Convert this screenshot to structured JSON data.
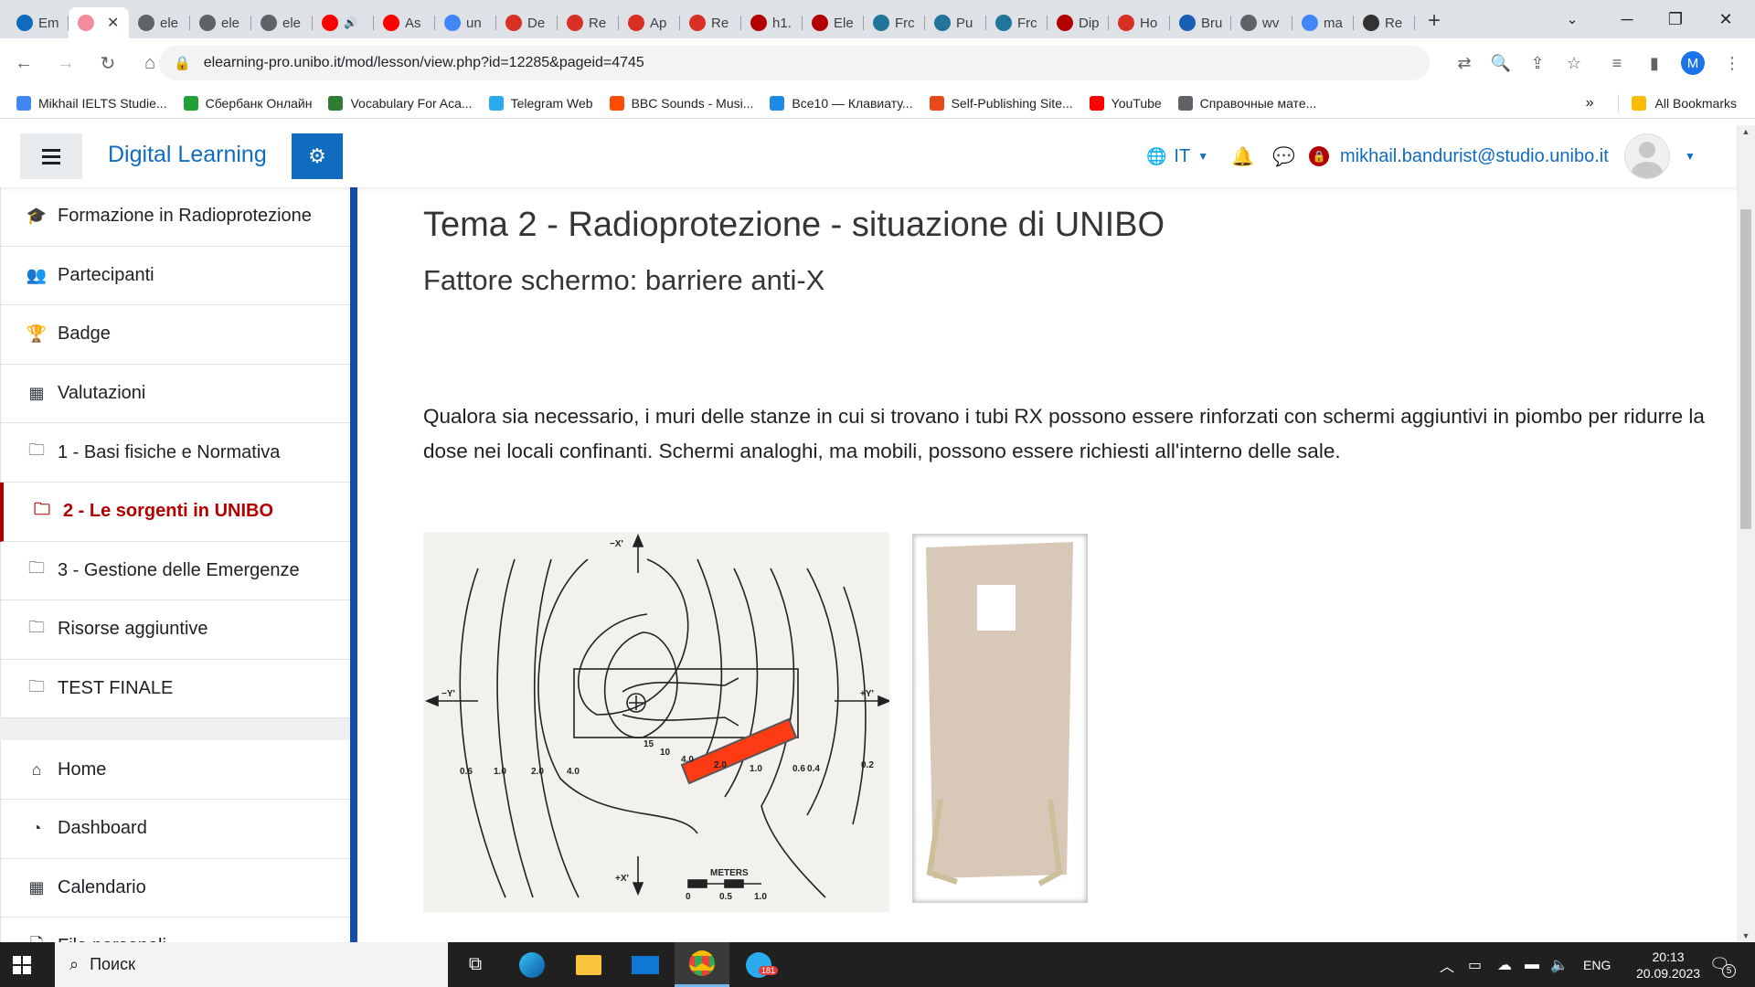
{
  "browser": {
    "tabs": [
      {
        "label": "Em",
        "icon": "outlook-icon",
        "color": "#0f6cbd"
      },
      {
        "label": "",
        "icon": "pink-flower-icon",
        "color": "#f28b9a",
        "active": true
      },
      {
        "label": "ele",
        "icon": "globe-icon",
        "color": "#5f6368"
      },
      {
        "label": "ele",
        "icon": "globe-icon",
        "color": "#5f6368"
      },
      {
        "label": "ele",
        "icon": "globe-icon",
        "color": "#5f6368"
      },
      {
        "label": "",
        "icon": "youtube-icon",
        "color": "#ff0000",
        "audio": true
      },
      {
        "label": "As",
        "icon": "youtube-icon",
        "color": "#ff0000"
      },
      {
        "label": "un",
        "icon": "google-icon",
        "color": "#4285f4"
      },
      {
        "label": "De",
        "icon": "red-circle-icon",
        "color": "#d93025"
      },
      {
        "label": "Re",
        "icon": "red-circle-icon",
        "color": "#d93025"
      },
      {
        "label": "Ap",
        "icon": "red-circle-icon",
        "color": "#d93025"
      },
      {
        "label": "Re",
        "icon": "red-star-icon",
        "color": "#d93025"
      },
      {
        "label": "h1.",
        "icon": "unibo-shield-icon",
        "color": "#b30000"
      },
      {
        "label": "Ele",
        "icon": "unibo-shield-icon",
        "color": "#b30000"
      },
      {
        "label": "Frc",
        "icon": "wordpress-icon",
        "color": "#21759b"
      },
      {
        "label": "Pu",
        "icon": "wordpress-icon",
        "color": "#21759b"
      },
      {
        "label": "Frc",
        "icon": "wordpress-icon",
        "color": "#21759b"
      },
      {
        "label": "Dip",
        "icon": "unibo-shield-icon",
        "color": "#b30000"
      },
      {
        "label": "Ho",
        "icon": "red-star-icon",
        "color": "#d93025"
      },
      {
        "label": "Bru",
        "icon": "blue-square-icon",
        "color": "#1a5fb4"
      },
      {
        "label": "wv",
        "icon": "globe-icon",
        "color": "#5f6368"
      },
      {
        "label": "ma",
        "icon": "google-icon",
        "color": "#4285f4"
      },
      {
        "label": "Re",
        "icon": "r6-icon",
        "color": "#333333"
      }
    ],
    "close_tab": "✕",
    "new_tab": "+",
    "address": "elearning-pro.unibo.it/mod/lesson/view.php?id=12285&pageid=4745",
    "profile_initial": "M",
    "bookmarks": [
      {
        "label": "Mikhail IELTS Studie...",
        "icon": "docs-icon",
        "color": "#4285f4"
      },
      {
        "label": "Сбербанк Онлайн",
        "icon": "sber-icon",
        "color": "#21a038"
      },
      {
        "label": "Vocabulary For Aca...",
        "icon": "ielts-icon",
        "color": "#2e7d32"
      },
      {
        "label": "Telegram Web",
        "icon": "telegram-icon",
        "color": "#2aabee"
      },
      {
        "label": "BBC Sounds - Musi...",
        "icon": "bbc-sounds-icon",
        "color": "#ff4c00"
      },
      {
        "label": "Все10 — Клавиату...",
        "icon": "vse10-icon",
        "color": "#1e88e5"
      },
      {
        "label": "Self-Publishing Site...",
        "icon": "p-icon",
        "color": "#e64a19"
      },
      {
        "label": "YouTube",
        "icon": "youtube-icon",
        "color": "#ff0000"
      },
      {
        "label": "Справочные мате...",
        "icon": "globe-icon",
        "color": "#5f6368"
      }
    ],
    "more_bookmarks": "»",
    "all_bookmarks": "All Bookmarks"
  },
  "moodle": {
    "site_name": "Digital Learning",
    "language": "IT",
    "user_email": "mikhail.bandurist@studio.unibo.it",
    "accent_color": "#0f6cbf",
    "active_color": "#b30000"
  },
  "drawer": {
    "course_items": [
      {
        "label": "Formazione in Radioprotezione",
        "icon": "graduation-cap-icon",
        "glyph": "🎓"
      },
      {
        "label": "Partecipanti",
        "icon": "users-icon",
        "glyph": "👥"
      },
      {
        "label": "Badge",
        "icon": "trophy-icon",
        "glyph": "🏆"
      },
      {
        "label": "Valutazioni",
        "icon": "table-icon",
        "glyph": "▦"
      },
      {
        "label": "1 - Basi fisiche e Normativa",
        "icon": "folder-icon",
        "glyph": "🗀"
      },
      {
        "label": "2 - Le sorgenti in UNIBO",
        "icon": "folder-icon",
        "glyph": "🗀",
        "active": true
      },
      {
        "label": "3 - Gestione delle Emergenze",
        "icon": "folder-icon",
        "glyph": "🗀"
      },
      {
        "label": "Risorse aggiuntive",
        "icon": "folder-icon",
        "glyph": "🗀"
      },
      {
        "label": "TEST FINALE",
        "icon": "folder-icon",
        "glyph": "🗀"
      }
    ],
    "site_items": [
      {
        "label": "Home",
        "icon": "home-icon",
        "glyph": "⌂"
      },
      {
        "label": "Dashboard",
        "icon": "dashboard-icon",
        "glyph": "◔"
      },
      {
        "label": "Calendario",
        "icon": "calendar-icon",
        "glyph": "▦"
      },
      {
        "label": "File personali",
        "icon": "file-icon",
        "glyph": "🗋"
      }
    ]
  },
  "content": {
    "title": "Tema 2 - Radioprotezione - situazione di UNIBO",
    "subtitle": "Fattore schermo: barriere anti-X",
    "paragraph": "Qualora sia necessario, i muri delle stanze in cui si trovano i tubi RX possono essere rinforzati con schermi aggiuntivi in piombo per ridurre la dose nei locali confinanti. Schermi analoghi, ma mobili, possono essere richiesti all'interno delle sale.",
    "figure1": {
      "axis_top": "−X'",
      "axis_bottom": "+X'",
      "axis_left": "−Y'",
      "axis_right": "+Y'",
      "contours_left": [
        "0.6",
        "1.0",
        "2.0",
        "4.0"
      ],
      "contours_center": [
        "15",
        "10",
        "4.0",
        "2.0",
        "1.0",
        "0.6",
        "0.4"
      ],
      "contour_right": "0.2",
      "scale_title": "METERS",
      "scale_ticks": [
        "0",
        "0.5",
        "1.0"
      ],
      "barrier_color": "#ff3b14"
    },
    "figure2": {
      "panel_color": "#d8c8b8"
    }
  },
  "taskbar": {
    "search_placeholder": "Поиск",
    "language": "ENG",
    "time": "20:13",
    "date": "20.09.2023",
    "telegram_badge": "181",
    "notification_count": "5"
  }
}
